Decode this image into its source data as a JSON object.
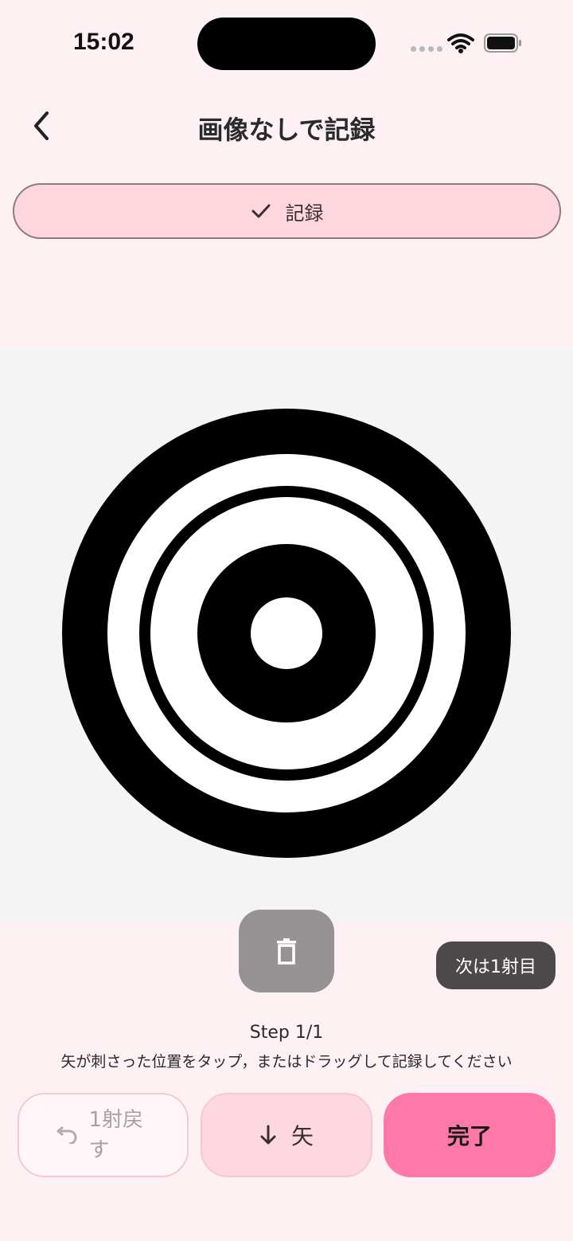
{
  "status": {
    "time": "15:02"
  },
  "header": {
    "title": "画像なしで記録"
  },
  "record_button": {
    "label": "記録"
  },
  "target": {
    "colors": {
      "background": "#f4f4f4",
      "black": "#000000",
      "white": "#ffffff"
    }
  },
  "next_badge": "次は1射目",
  "step": "Step 1/1",
  "instruction": "矢が刺さった位置をタップ，またはドラッグして記録してください",
  "buttons": {
    "undo": "1射戻す",
    "arrow": "矢",
    "done": "完了"
  },
  "icons": {
    "back": "chevron-left-icon",
    "check": "check-icon",
    "trash": "trash-icon",
    "undo": "undo-icon",
    "arrow_down": "arrow-down-icon",
    "wifi": "wifi-icon",
    "battery": "battery-icon"
  },
  "colors": {
    "page_bg": "#fdf1f4",
    "accent": "#fe79a7",
    "record_bg": "#fdd6de"
  }
}
